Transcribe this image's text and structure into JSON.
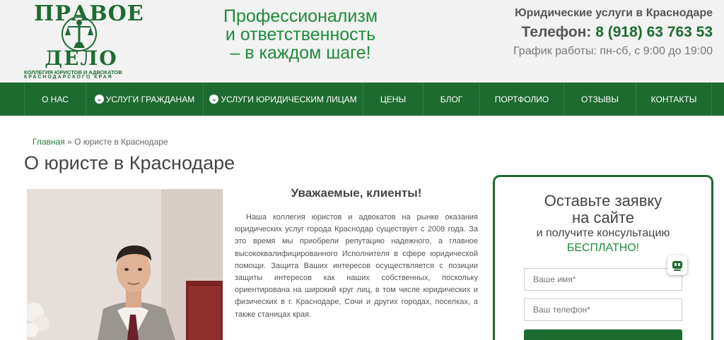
{
  "header": {
    "logo": {
      "top": "ПРАВОЕ",
      "bottom": "ДЕЛО",
      "sub1": "КОЛЛЕГИЯ ЮРИСТОВ И АДВОКАТОВ",
      "sub2": "КРАСНОДАРСКОГО КРАЯ"
    },
    "slogan": [
      "Профессионализм",
      "и ответственность",
      "– в каждом шаге!"
    ],
    "city": "Юридические услуги в Краснодаре",
    "phone_label": "Телефон:",
    "phone_number": "8 (918) 63 763 53",
    "hours": "График работы: пн-сб, с 9:00 до 19:00"
  },
  "nav": [
    {
      "label": "О нас",
      "dropdown": false
    },
    {
      "label": "Услуги гражданам",
      "dropdown": true
    },
    {
      "label": "Услуги юридическим лицам",
      "dropdown": true
    },
    {
      "label": "Цены",
      "dropdown": false
    },
    {
      "label": "Блог",
      "dropdown": false
    },
    {
      "label": "Портфолио",
      "dropdown": false
    },
    {
      "label": "Отзывы",
      "dropdown": false
    },
    {
      "label": "Контакты",
      "dropdown": false
    }
  ],
  "breadcrumb": {
    "home": "Главная",
    "separator": "»",
    "current": "О юристе в Краснодаре"
  },
  "page_title": "О юристе в Краснодаре",
  "article": {
    "title": "Уважаемые, клиенты!",
    "text": "Наша коллегия юристов и адвокатов на рынке оказания юридических услуг города Краснодар существует с 2008 года. За это время мы приобрели репутацию надежного, а главное высококвалифицированного Исполнителя в сфере юридической помощи. Защита Ваших интересов осуществляется с позиции защиты интересов как наших собственных, поскольку ориентирована на широкий круг лиц, в том числе юридических и физических в г. Краснодаре, Сочи и других городах, поселках, а также станицах края."
  },
  "form": {
    "title_line1": "Оставьте заявку",
    "title_line2": "на сайте",
    "subtitle": "и получите консультацию",
    "free": "БЕСПЛАТНО!",
    "name_placeholder": "Ваше имя*",
    "phone_placeholder": "Ваш телефон*"
  },
  "colors": {
    "brand_green": "#1d6b31",
    "accent_green": "#1e8a3c"
  },
  "icons": [
    "scales-of-justice-icon",
    "chevron-down-icon",
    "chat-widget-icon"
  ]
}
